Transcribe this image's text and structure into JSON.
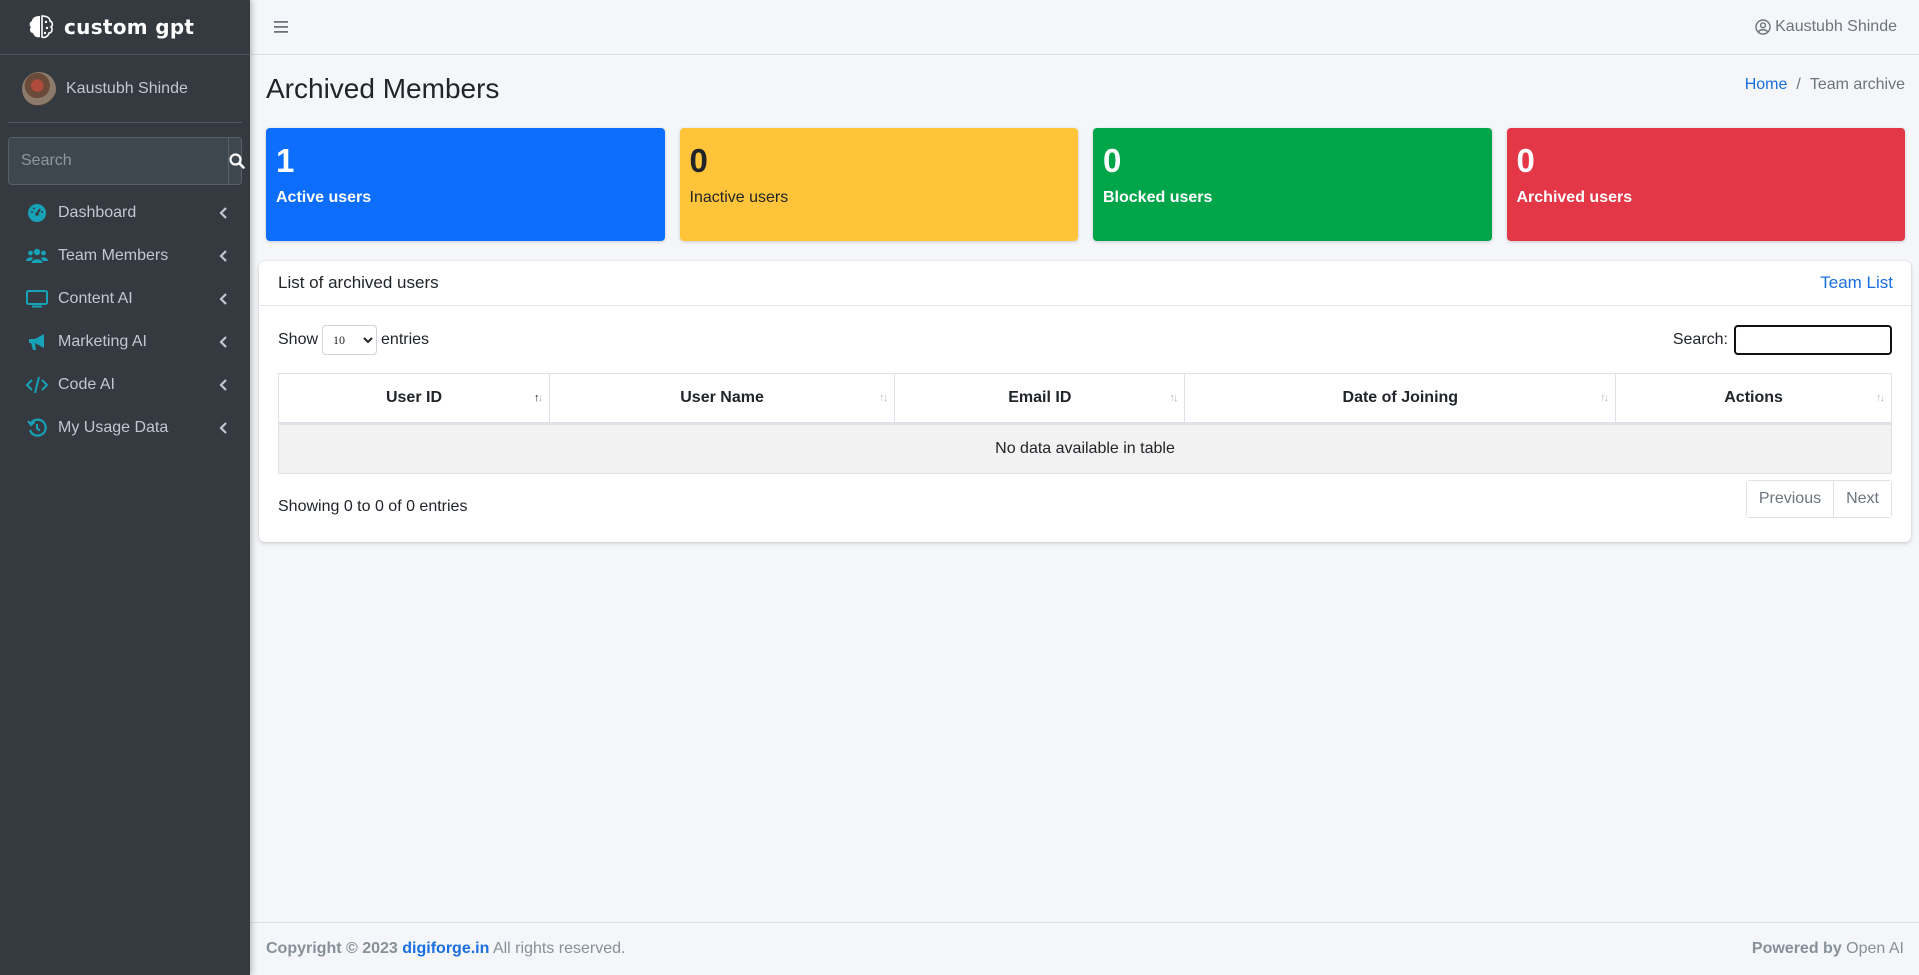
{
  "app": {
    "brand_name": "custom gpt"
  },
  "sidebar": {
    "user_name": "Kaustubh Shinde",
    "search_placeholder": "Search",
    "items": [
      {
        "label": "Dashboard",
        "icon": "tachometer-icon"
      },
      {
        "label": "Team Members",
        "icon": "users-icon"
      },
      {
        "label": "Content AI",
        "icon": "monitor-icon"
      },
      {
        "label": "Marketing AI",
        "icon": "megaphone-icon"
      },
      {
        "label": "Code AI",
        "icon": "code-icon"
      },
      {
        "label": "My Usage Data",
        "icon": "history-icon"
      }
    ]
  },
  "header": {
    "user_name": "Kaustubh Shinde"
  },
  "page": {
    "title": "Archived Members",
    "breadcrumb": {
      "home": "Home",
      "separator": "/",
      "current": "Team archive"
    }
  },
  "stats": [
    {
      "value": "1",
      "label": "Active users",
      "color": "#0d6efd"
    },
    {
      "value": "0",
      "label": "Inactive users",
      "color": "#ffc439"
    },
    {
      "value": "0",
      "label": "Blocked users",
      "color": "#00a54a"
    },
    {
      "value": "0",
      "label": "Archived users",
      "color": "#e33747"
    }
  ],
  "card": {
    "title": "List of archived users",
    "link": "Team List",
    "show_label": "Show",
    "entries_label": "entries",
    "page_length": "10",
    "search_label": "Search:",
    "search_value": "",
    "columns": [
      "User ID",
      "User Name",
      "Email ID",
      "Date of Joining",
      "Actions"
    ],
    "empty_message": "No data available in table",
    "info": "Showing 0 to 0 of 0 entries",
    "prev_label": "Previous",
    "next_label": "Next"
  },
  "footer": {
    "copyright_prefix": "Copyright © 2023",
    "company_link": "digiforge.in",
    "rights": "All rights reserved.",
    "powered_label": "Powered by",
    "powered_value": "Open AI"
  }
}
